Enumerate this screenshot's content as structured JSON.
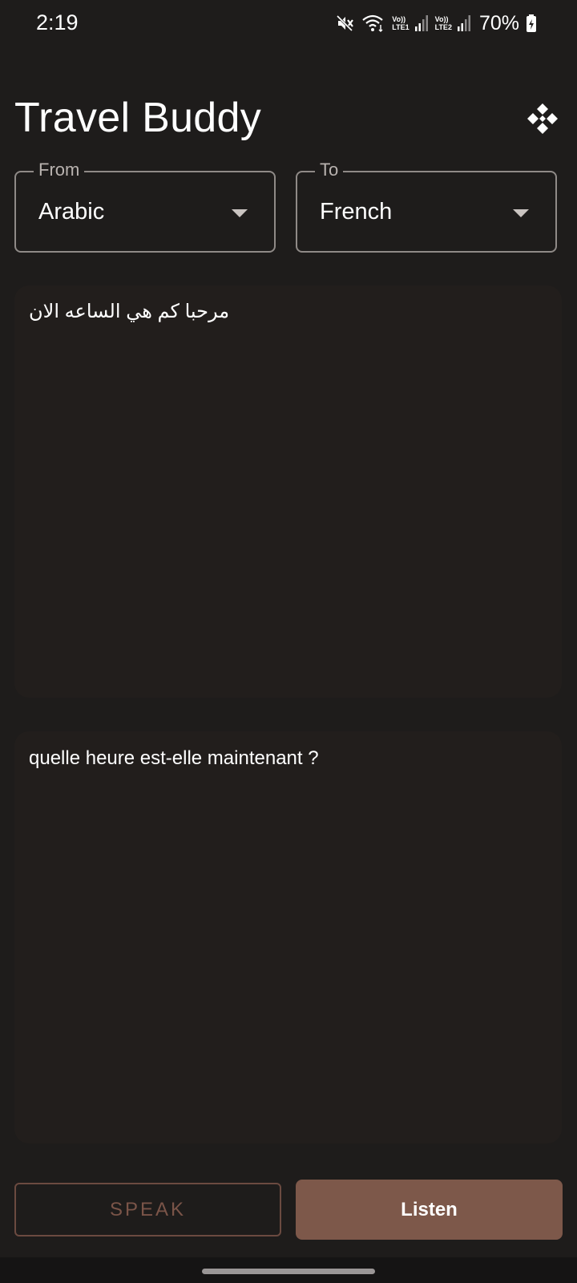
{
  "status_bar": {
    "time": "2:19",
    "battery_percent": "70%",
    "sim1_label_top": "Vo))",
    "sim1_label_bottom": "LTE1",
    "sim2_label_top": "Vo))",
    "sim2_label_bottom": "LTE2",
    "icons": [
      "mute-icon",
      "wifi-icon",
      "signal-icon",
      "signal-icon",
      "battery-charging-icon"
    ]
  },
  "header": {
    "title": "Travel Buddy",
    "menu_icon": "diamond-grid-icon"
  },
  "language_selectors": {
    "from": {
      "label": "From",
      "value": "Arabic"
    },
    "to": {
      "label": "To",
      "value": "French"
    }
  },
  "source_text": "مرحبا كم هي الساعه الان",
  "translated_text": "quelle heure est-elle maintenant ?",
  "actions": {
    "speak_label": "SPEAK",
    "listen_label": "Listen"
  },
  "colors": {
    "background": "#1e1c1b",
    "text_area": "#221e1c",
    "accent": "#7d584a",
    "outline": "#8f8a87"
  }
}
